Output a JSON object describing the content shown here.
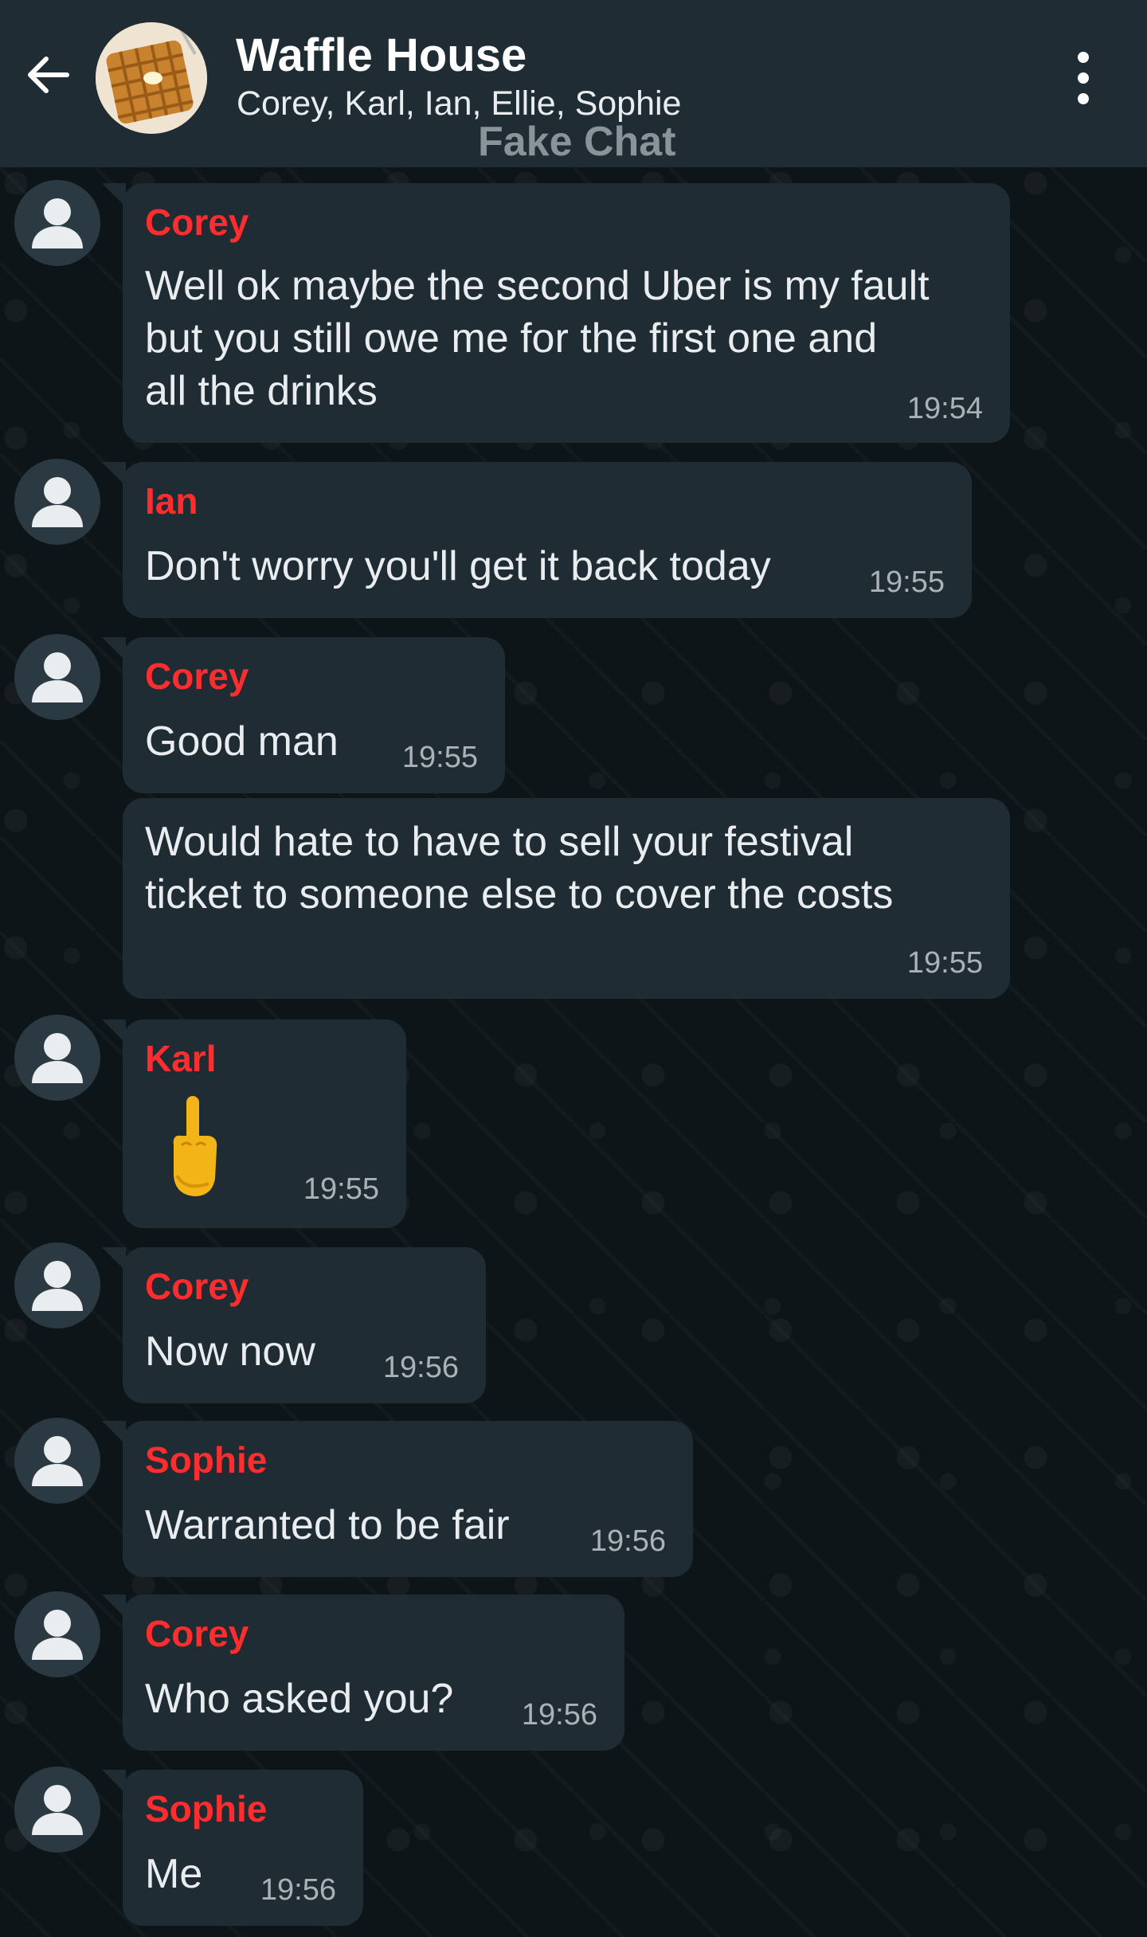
{
  "header": {
    "title": "Waffle House",
    "members": "Corey, Karl, Ian, Ellie, Sophie",
    "watermark": "Fake Chat"
  },
  "colors": {
    "header_bg": "#1f2c34",
    "bubble_bg": "#1f2c34",
    "sender_name": "#ff2d2d",
    "timestamp": "#aab2b8"
  },
  "messages": [
    {
      "sender": "Corey",
      "lines": [
        "Well ok maybe the second Uber is my fault",
        "but you still owe me for the first one and",
        "all the drinks"
      ],
      "time": "19:54"
    },
    {
      "sender": "Ian",
      "lines": [
        "Don't worry you'll get it back today"
      ],
      "time": "19:55"
    },
    {
      "sender": "Corey",
      "lines": [
        "Good man"
      ],
      "time": "19:55"
    },
    {
      "sender": "",
      "lines": [
        "Would hate to have to sell your festival",
        "ticket to someone else to cover the costs"
      ],
      "time": "19:55"
    },
    {
      "sender": "Karl",
      "emoji": "middle-finger-emoji",
      "time": "19:55"
    },
    {
      "sender": "Corey",
      "lines": [
        "Now now"
      ],
      "time": "19:56"
    },
    {
      "sender": "Sophie",
      "lines": [
        "Warranted to be fair"
      ],
      "time": "19:56"
    },
    {
      "sender": "Corey",
      "lines": [
        "Who asked you?"
      ],
      "time": "19:56"
    },
    {
      "sender": "Sophie",
      "lines": [
        "Me"
      ],
      "time": "19:56"
    }
  ]
}
